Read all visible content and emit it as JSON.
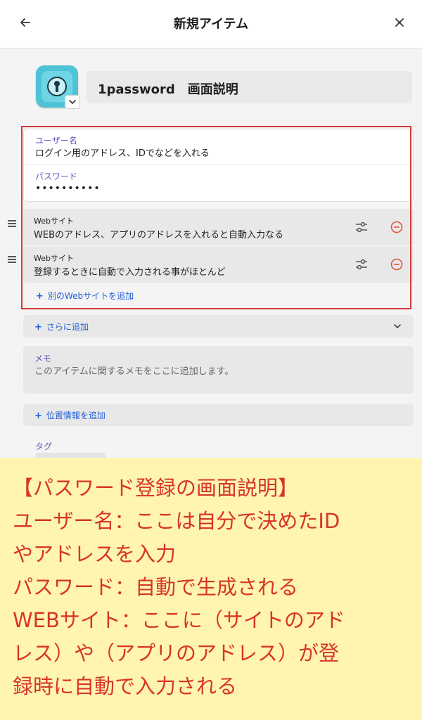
{
  "header": {
    "title": "新規アイテム",
    "back_icon": "arrow-left-icon",
    "close_icon": "close-icon"
  },
  "item": {
    "title": "1password　画面説明",
    "icon": "keyhole-icon"
  },
  "fields": {
    "username": {
      "label": "ユーザー名",
      "value": "ログイン用のアドレス、IDでなどを入れる"
    },
    "password": {
      "label": "パスワード",
      "value": "••••••••••"
    }
  },
  "websites": [
    {
      "label": "Webサイト",
      "value": "WEBのアドレス、アプリのアドレスを入れると自動入力なる"
    },
    {
      "label": "Webサイト",
      "value": "登録するときに自動で入力される事がほとんど"
    }
  ],
  "actions": {
    "add_website": "別のWebサイトを追加",
    "add_more": "さらに追加",
    "add_location": "位置情報を追加"
  },
  "memo": {
    "label": "メモ",
    "placeholder": "このアイテムに関するメモをここに追加します。"
  },
  "tags": {
    "label": "タグ"
  },
  "annotation": {
    "lines": [
      "【パスワード登録の画面説明】",
      "ユーザー名：ここは自分で決めたID",
      "やアドレスを入力",
      "パスワード：自動で生成される",
      "WEBサイト：ここに（サイトのアド",
      "レス）や（アプリのアドレス）が登",
      "録時に自動で入力される"
    ]
  },
  "colors": {
    "accent_label": "#6f4fbf",
    "link": "#1f5fd6",
    "highlight_border": "#d63a3a",
    "note_background": "#fff5b0",
    "note_text": "#d9342b",
    "remove": "#e0553e"
  }
}
